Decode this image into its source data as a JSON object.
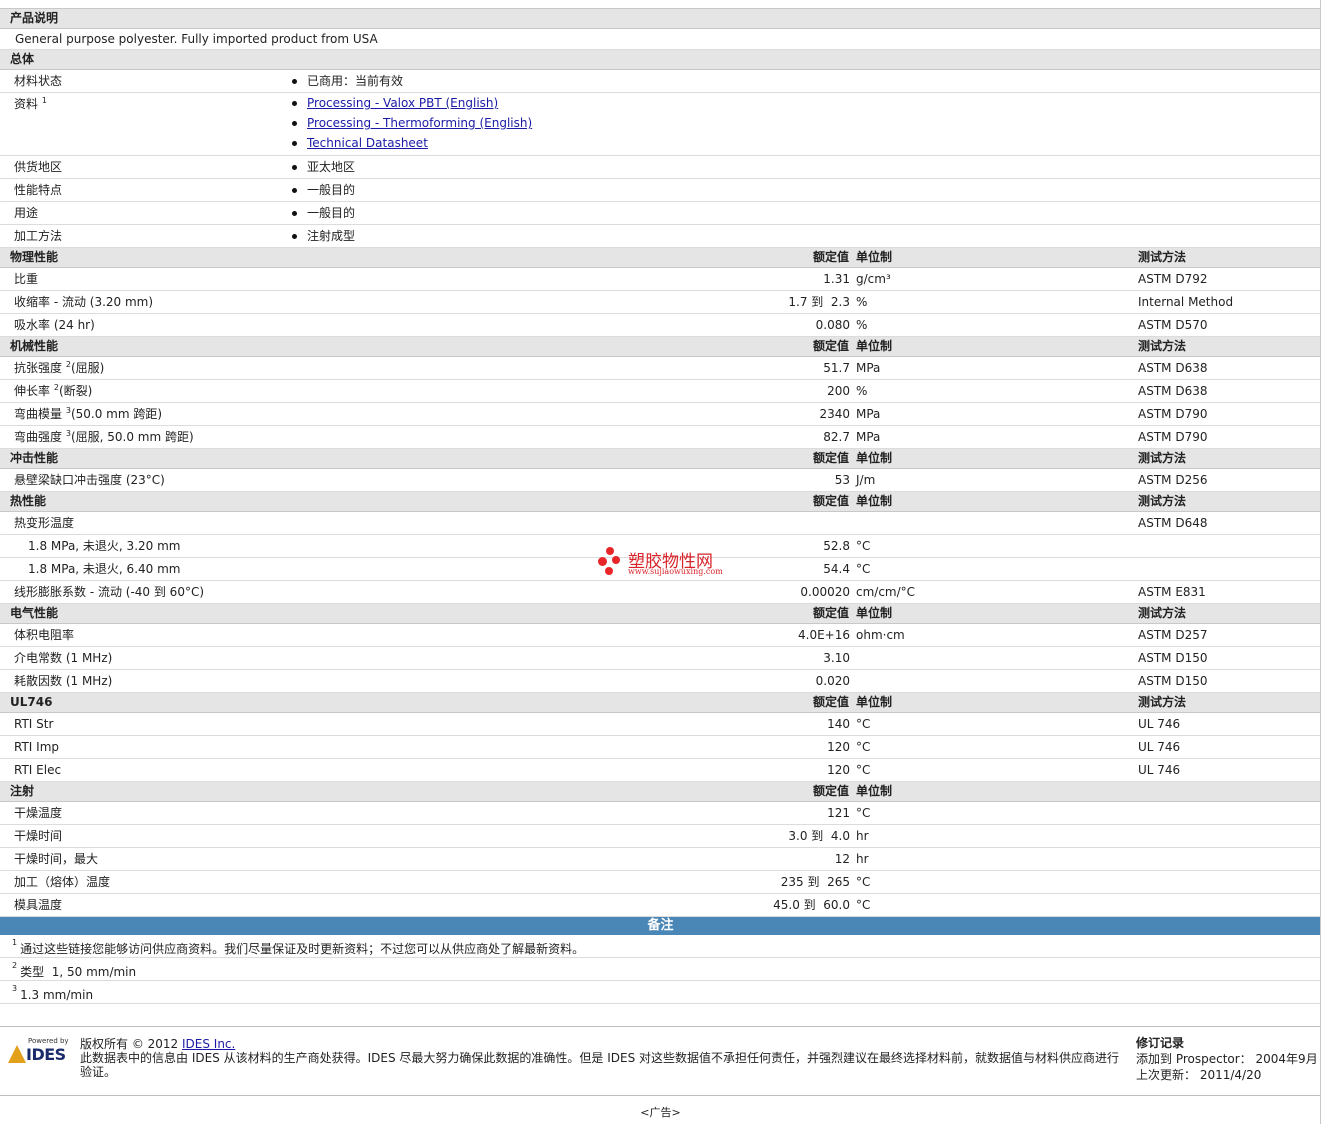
{
  "description_section": {
    "title": "产品说明",
    "text": "General purpose polyester. Fully imported product from USA"
  },
  "general": {
    "title": "总体",
    "rows": [
      {
        "label": "材料状态",
        "items": [
          "已商用：当前有效"
        ]
      },
      {
        "label": "资料",
        "sup": "1",
        "links": [
          "Processing - Valox PBT (English)",
          "Processing - Thermoforming (English)",
          "Technical Datasheet"
        ]
      },
      {
        "label": "供货地区",
        "items": [
          "亚太地区"
        ]
      },
      {
        "label": "性能特点",
        "items": [
          "一般目的"
        ]
      },
      {
        "label": "用途",
        "items": [
          "一般目的"
        ]
      },
      {
        "label": "加工方法",
        "items": [
          "注射成型"
        ]
      }
    ]
  },
  "headers": {
    "value": "额定值",
    "unit": "单位制",
    "method": "测试方法"
  },
  "physical": {
    "title": "物理性能",
    "rows": [
      {
        "label": "比重",
        "value": "1.31",
        "unit": "g/cm³",
        "method": "ASTM D792"
      },
      {
        "label": "收缩率 - 流动 (3.20 mm)",
        "value": "1.7 到  2.3",
        "unit": "%",
        "method": "Internal Method"
      },
      {
        "label": "吸水率 (24 hr)",
        "value": "0.080",
        "unit": "%",
        "method": "ASTM D570"
      }
    ]
  },
  "mechanical": {
    "title": "机械性能",
    "rows": [
      {
        "label": "抗张强度",
        "sup": "2",
        "suffix": "(屈服)",
        "value": "51.7",
        "unit": "MPa",
        "method": "ASTM D638"
      },
      {
        "label": "伸长率",
        "sup": "2",
        "suffix": "(断裂)",
        "value": "200",
        "unit": "%",
        "method": "ASTM D638"
      },
      {
        "label": "弯曲模量",
        "sup": "3",
        "suffix": "(50.0 mm 跨距)",
        "value": "2340",
        "unit": "MPa",
        "method": "ASTM D790"
      },
      {
        "label": "弯曲强度",
        "sup": "3",
        "suffix": "(屈服, 50.0 mm 跨距)",
        "value": "82.7",
        "unit": "MPa",
        "method": "ASTM D790"
      }
    ]
  },
  "impact": {
    "title": "冲击性能",
    "rows": [
      {
        "label": "悬壁梁缺口冲击强度 (23°C)",
        "value": "53",
        "unit": "J/m",
        "method": "ASTM D256"
      }
    ]
  },
  "thermal": {
    "title": "热性能",
    "rows": [
      {
        "label": "热变形温度",
        "value": "",
        "unit": "",
        "method": "ASTM D648"
      },
      {
        "label": "1.8 MPa, 未退火, 3.20 mm",
        "indent": true,
        "value": "52.8",
        "unit": "°C",
        "method": ""
      },
      {
        "label": "1.8 MPa, 未退火, 6.40 mm",
        "indent": true,
        "value": "54.4",
        "unit": "°C",
        "method": ""
      },
      {
        "label": "线形膨胀系数 - 流动 (-40 到  60°C)",
        "value": "0.00020",
        "unit": "cm/cm/°C",
        "method": "ASTM E831"
      }
    ]
  },
  "electrical": {
    "title": "电气性能",
    "rows": [
      {
        "label": "体积电阻率",
        "value": "4.0E+16",
        "unit": "ohm·cm",
        "method": "ASTM D257"
      },
      {
        "label": "介电常数 (1 MHz)",
        "value": "3.10",
        "unit": "",
        "method": "ASTM D150"
      },
      {
        "label": "耗散因数 (1 MHz)",
        "value": "0.020",
        "unit": "",
        "method": "ASTM D150"
      }
    ]
  },
  "ul746": {
    "title": "UL746",
    "rows": [
      {
        "label": "RTI Str",
        "value": "140",
        "unit": "°C",
        "method": "UL 746"
      },
      {
        "label": "RTI Imp",
        "value": "120",
        "unit": "°C",
        "method": "UL 746"
      },
      {
        "label": "RTI Elec",
        "value": "120",
        "unit": "°C",
        "method": "UL 746"
      }
    ]
  },
  "injection": {
    "title": "注射",
    "rows": [
      {
        "label": "干燥温度",
        "value": "121",
        "unit": "°C",
        "method": ""
      },
      {
        "label": "干燥时间",
        "value": "3.0 到  4.0",
        "unit": "hr",
        "method": ""
      },
      {
        "label": "干燥时间，最大",
        "value": "12",
        "unit": "hr",
        "method": ""
      },
      {
        "label": "加工（熔体）温度",
        "value": "235 到  265",
        "unit": "°C",
        "method": ""
      },
      {
        "label": "模具温度",
        "value": "45.0 到  60.0",
        "unit": "°C",
        "method": ""
      }
    ]
  },
  "notes": {
    "title": "备注",
    "items": [
      {
        "num": "1",
        "text": "通过这些链接您能够访问供应商资料。我们尽量保证及时更新资料；不过您可以从供应商处了解最新资料。"
      },
      {
        "num": "2",
        "text": "类型  1, 50 mm/min"
      },
      {
        "num": "3",
        "text": "1.3 mm/min"
      }
    ]
  },
  "footer": {
    "logo_powered": "Powered by",
    "logo_text": "IDES",
    "copyright_prefix": "版权所有 © 2012 ",
    "copyright_link": "IDES Inc.",
    "disclaimer": "此数据表中的信息由 IDES 从该材料的生产商处获得。IDES 尽最大努力确保此数据的准确性。但是 IDES 对这些数据值不承担任何责任，并强烈建议在最终选择材料前，就数据值与材料供应商进行验证。",
    "revision_title": "修订记录",
    "added_label": "添加到 Prospector：",
    "added_value": "2004年9月",
    "updated_label": "上次更新：",
    "updated_value": "2011/4/20"
  },
  "ad_text": "<广告>",
  "watermark": {
    "cn": "塑胶物性网",
    "url": "www.sujiaowuxing.com",
    "color": "#d9232a"
  }
}
